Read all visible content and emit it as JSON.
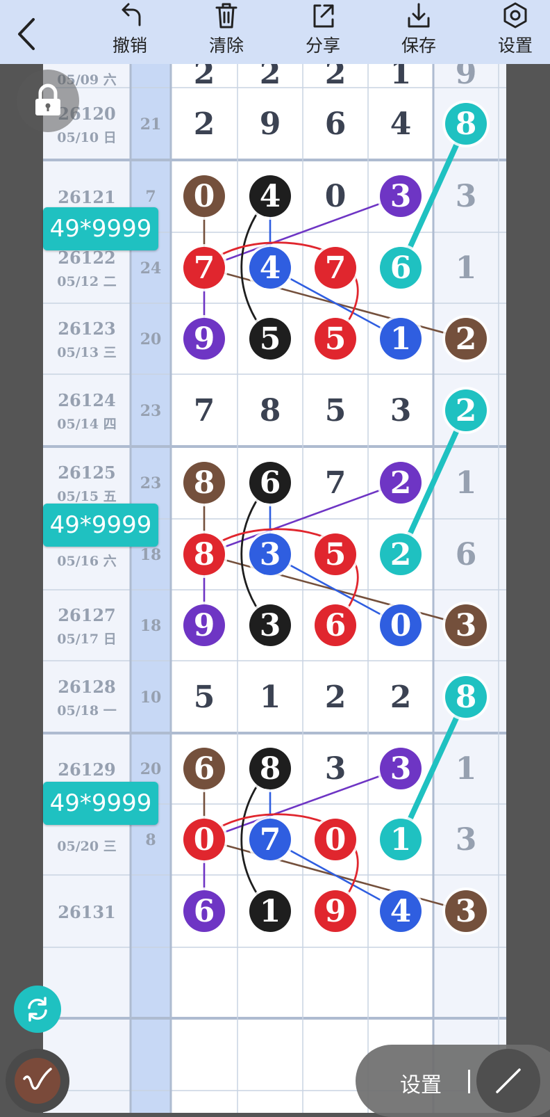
{
  "toolbar": {
    "buttons": [
      {
        "label": "撤销",
        "icon": "undo-icon"
      },
      {
        "label": "清除",
        "icon": "trash-icon"
      },
      {
        "label": "分享",
        "icon": "share-icon"
      },
      {
        "label": "保存",
        "icon": "download-icon"
      },
      {
        "label": "设置",
        "icon": "settings-gear-icon"
      }
    ]
  },
  "label_badges": [
    "49*9999",
    "49*9999",
    "49*9999"
  ],
  "colors": {
    "brown": "#74503c",
    "black": "#1e1e1e",
    "red": "#e0262e",
    "purple": "#6e35c4",
    "blue": "#2f5ee0",
    "teal": "#1fc1c1",
    "grid": "#c9d3e2",
    "col_bg": "#f1f4fb",
    "digit": "#3b4252",
    "gray_digit": "#96a0b0"
  },
  "rows": [
    {
      "issue": "",
      "date": "05/09 六",
      "sum": "",
      "digits": [
        "2",
        "2",
        "2",
        "1"
      ],
      "tail": "9",
      "partial": true
    },
    {
      "issue": "26120",
      "date": "05/10 日",
      "sum": "21",
      "digits": [
        "2",
        "9",
        "6",
        "4"
      ],
      "tail": "8"
    },
    {
      "issue": "26121",
      "date": "",
      "sum": "7",
      "digits": [
        "0",
        "4",
        "0",
        "3"
      ],
      "tail": "3"
    },
    {
      "issue": "26122",
      "date": "05/12 二",
      "sum": "24",
      "digits": [
        "7",
        "4",
        "7",
        "6"
      ],
      "tail": "1"
    },
    {
      "issue": "26123",
      "date": "05/13 三",
      "sum": "20",
      "digits": [
        "9",
        "5",
        "5",
        "1"
      ],
      "tail": "2"
    },
    {
      "issue": "26124",
      "date": "05/14 四",
      "sum": "23",
      "digits": [
        "7",
        "8",
        "5",
        "3"
      ],
      "tail": "2"
    },
    {
      "issue": "26125",
      "date": "05/15 五",
      "sum": "23",
      "digits": [
        "8",
        "6",
        "7",
        "2"
      ],
      "tail": "1"
    },
    {
      "issue": "",
      "date": "05/16 六",
      "sum": "18",
      "digits": [
        "8",
        "3",
        "5",
        "2"
      ],
      "tail": "6"
    },
    {
      "issue": "26127",
      "date": "05/17 日",
      "sum": "18",
      "digits": [
        "9",
        "3",
        "6",
        "0"
      ],
      "tail": "3"
    },
    {
      "issue": "26128",
      "date": "05/18 一",
      "sum": "10",
      "digits": [
        "5",
        "1",
        "2",
        "2"
      ],
      "tail": "8"
    },
    {
      "issue": "26129",
      "date": "",
      "sum": "20",
      "digits": [
        "6",
        "8",
        "3",
        "3"
      ],
      "tail": "1"
    },
    {
      "issue": "",
      "date": "05/20 三",
      "sum": "8",
      "digits": [
        "0",
        "7",
        "0",
        "1"
      ],
      "tail": "3"
    },
    {
      "issue": "26131",
      "date": "",
      "sum": "",
      "digits": [
        "6",
        "1",
        "9",
        "4"
      ],
      "tail": "3"
    },
    {
      "issue": "",
      "date": "",
      "sum": "",
      "digits": [
        "",
        "",
        "",
        ""
      ],
      "tail": ""
    }
  ],
  "circles": [
    {
      "row": 1,
      "col": 4,
      "color": "teal"
    },
    {
      "row": 2,
      "col": 0,
      "color": "brown"
    },
    {
      "row": 2,
      "col": 1,
      "color": "black"
    },
    {
      "row": 2,
      "col": 3,
      "color": "purple"
    },
    {
      "row": 3,
      "col": 0,
      "color": "red"
    },
    {
      "row": 3,
      "col": 1,
      "color": "blue"
    },
    {
      "row": 3,
      "col": 2,
      "color": "red"
    },
    {
      "row": 3,
      "col": 3,
      "color": "teal"
    },
    {
      "row": 4,
      "col": 0,
      "color": "purple"
    },
    {
      "row": 4,
      "col": 1,
      "color": "black"
    },
    {
      "row": 4,
      "col": 2,
      "color": "red"
    },
    {
      "row": 4,
      "col": 3,
      "color": "blue"
    },
    {
      "row": 4,
      "col": 4,
      "color": "brown"
    },
    {
      "row": 5,
      "col": 4,
      "color": "teal"
    },
    {
      "row": 6,
      "col": 0,
      "color": "brown"
    },
    {
      "row": 6,
      "col": 1,
      "color": "black"
    },
    {
      "row": 6,
      "col": 3,
      "color": "purple"
    },
    {
      "row": 7,
      "col": 0,
      "color": "red"
    },
    {
      "row": 7,
      "col": 1,
      "color": "blue"
    },
    {
      "row": 7,
      "col": 2,
      "color": "red"
    },
    {
      "row": 7,
      "col": 3,
      "color": "teal"
    },
    {
      "row": 8,
      "col": 0,
      "color": "purple"
    },
    {
      "row": 8,
      "col": 1,
      "color": "black"
    },
    {
      "row": 8,
      "col": 2,
      "color": "red"
    },
    {
      "row": 8,
      "col": 3,
      "color": "blue"
    },
    {
      "row": 8,
      "col": 4,
      "color": "brown"
    },
    {
      "row": 9,
      "col": 4,
      "color": "teal"
    },
    {
      "row": 10,
      "col": 0,
      "color": "brown"
    },
    {
      "row": 10,
      "col": 1,
      "color": "black"
    },
    {
      "row": 10,
      "col": 3,
      "color": "purple"
    },
    {
      "row": 11,
      "col": 0,
      "color": "red"
    },
    {
      "row": 11,
      "col": 1,
      "color": "blue"
    },
    {
      "row": 11,
      "col": 2,
      "color": "red"
    },
    {
      "row": 11,
      "col": 3,
      "color": "teal"
    },
    {
      "row": 12,
      "col": 0,
      "color": "purple"
    },
    {
      "row": 12,
      "col": 1,
      "color": "black"
    },
    {
      "row": 12,
      "col": 2,
      "color": "red"
    },
    {
      "row": 12,
      "col": 3,
      "color": "blue"
    },
    {
      "row": 12,
      "col": 4,
      "color": "brown"
    }
  ],
  "links": [
    {
      "from": [
        1,
        4
      ],
      "to": [
        3,
        3
      ],
      "color": "teal",
      "kind": "thick"
    },
    {
      "from": [
        2,
        0
      ],
      "to": [
        3,
        0
      ],
      "color": "brown",
      "kind": "line"
    },
    {
      "from": [
        3,
        0
      ],
      "to": [
        4,
        0
      ],
      "color": "purple",
      "kind": "line"
    },
    {
      "from": [
        2,
        1
      ],
      "to": [
        3,
        1
      ],
      "color": "blue",
      "kind": "line"
    },
    {
      "from": [
        3,
        0
      ],
      "to": [
        2,
        3
      ],
      "color": "purple",
      "kind": "line"
    },
    {
      "from": [
        3,
        0
      ],
      "to": [
        4,
        4
      ],
      "color": "brown",
      "kind": "line"
    },
    {
      "from": [
        3,
        1
      ],
      "to": [
        4,
        3
      ],
      "color": "blue",
      "kind": "line"
    },
    {
      "from": [
        2,
        1
      ],
      "to": [
        4,
        1
      ],
      "color": "black",
      "kind": "arc"
    },
    {
      "from": [
        3,
        0
      ],
      "to": [
        4,
        2
      ],
      "color": "red",
      "kind": "arc"
    },
    {
      "from": [
        5,
        4
      ],
      "to": [
        7,
        3
      ],
      "color": "teal",
      "kind": "thick"
    },
    {
      "from": [
        6,
        0
      ],
      "to": [
        7,
        0
      ],
      "color": "brown",
      "kind": "line"
    },
    {
      "from": [
        7,
        0
      ],
      "to": [
        8,
        0
      ],
      "color": "purple",
      "kind": "line"
    },
    {
      "from": [
        6,
        1
      ],
      "to": [
        7,
        1
      ],
      "color": "blue",
      "kind": "line"
    },
    {
      "from": [
        7,
        0
      ],
      "to": [
        6,
        3
      ],
      "color": "purple",
      "kind": "line"
    },
    {
      "from": [
        7,
        0
      ],
      "to": [
        8,
        4
      ],
      "color": "brown",
      "kind": "line"
    },
    {
      "from": [
        7,
        1
      ],
      "to": [
        8,
        3
      ],
      "color": "blue",
      "kind": "line"
    },
    {
      "from": [
        6,
        1
      ],
      "to": [
        8,
        1
      ],
      "color": "black",
      "kind": "arc"
    },
    {
      "from": [
        7,
        0
      ],
      "to": [
        8,
        2
      ],
      "color": "red",
      "kind": "arc"
    },
    {
      "from": [
        9,
        4
      ],
      "to": [
        11,
        3
      ],
      "color": "teal",
      "kind": "thick"
    },
    {
      "from": [
        10,
        0
      ],
      "to": [
        11,
        0
      ],
      "color": "brown",
      "kind": "line"
    },
    {
      "from": [
        11,
        0
      ],
      "to": [
        12,
        0
      ],
      "color": "purple",
      "kind": "line"
    },
    {
      "from": [
        10,
        1
      ],
      "to": [
        11,
        1
      ],
      "color": "blue",
      "kind": "line"
    },
    {
      "from": [
        11,
        0
      ],
      "to": [
        10,
        3
      ],
      "color": "purple",
      "kind": "line"
    },
    {
      "from": [
        11,
        0
      ],
      "to": [
        12,
        4
      ],
      "color": "brown",
      "kind": "line"
    },
    {
      "from": [
        11,
        1
      ],
      "to": [
        12,
        3
      ],
      "color": "blue",
      "kind": "line"
    },
    {
      "from": [
        10,
        1
      ],
      "to": [
        12,
        1
      ],
      "color": "black",
      "kind": "arc"
    },
    {
      "from": [
        11,
        0
      ],
      "to": [
        12,
        2
      ],
      "color": "red",
      "kind": "arc"
    }
  ],
  "bottom_bar": {
    "settings_label": "设置"
  }
}
